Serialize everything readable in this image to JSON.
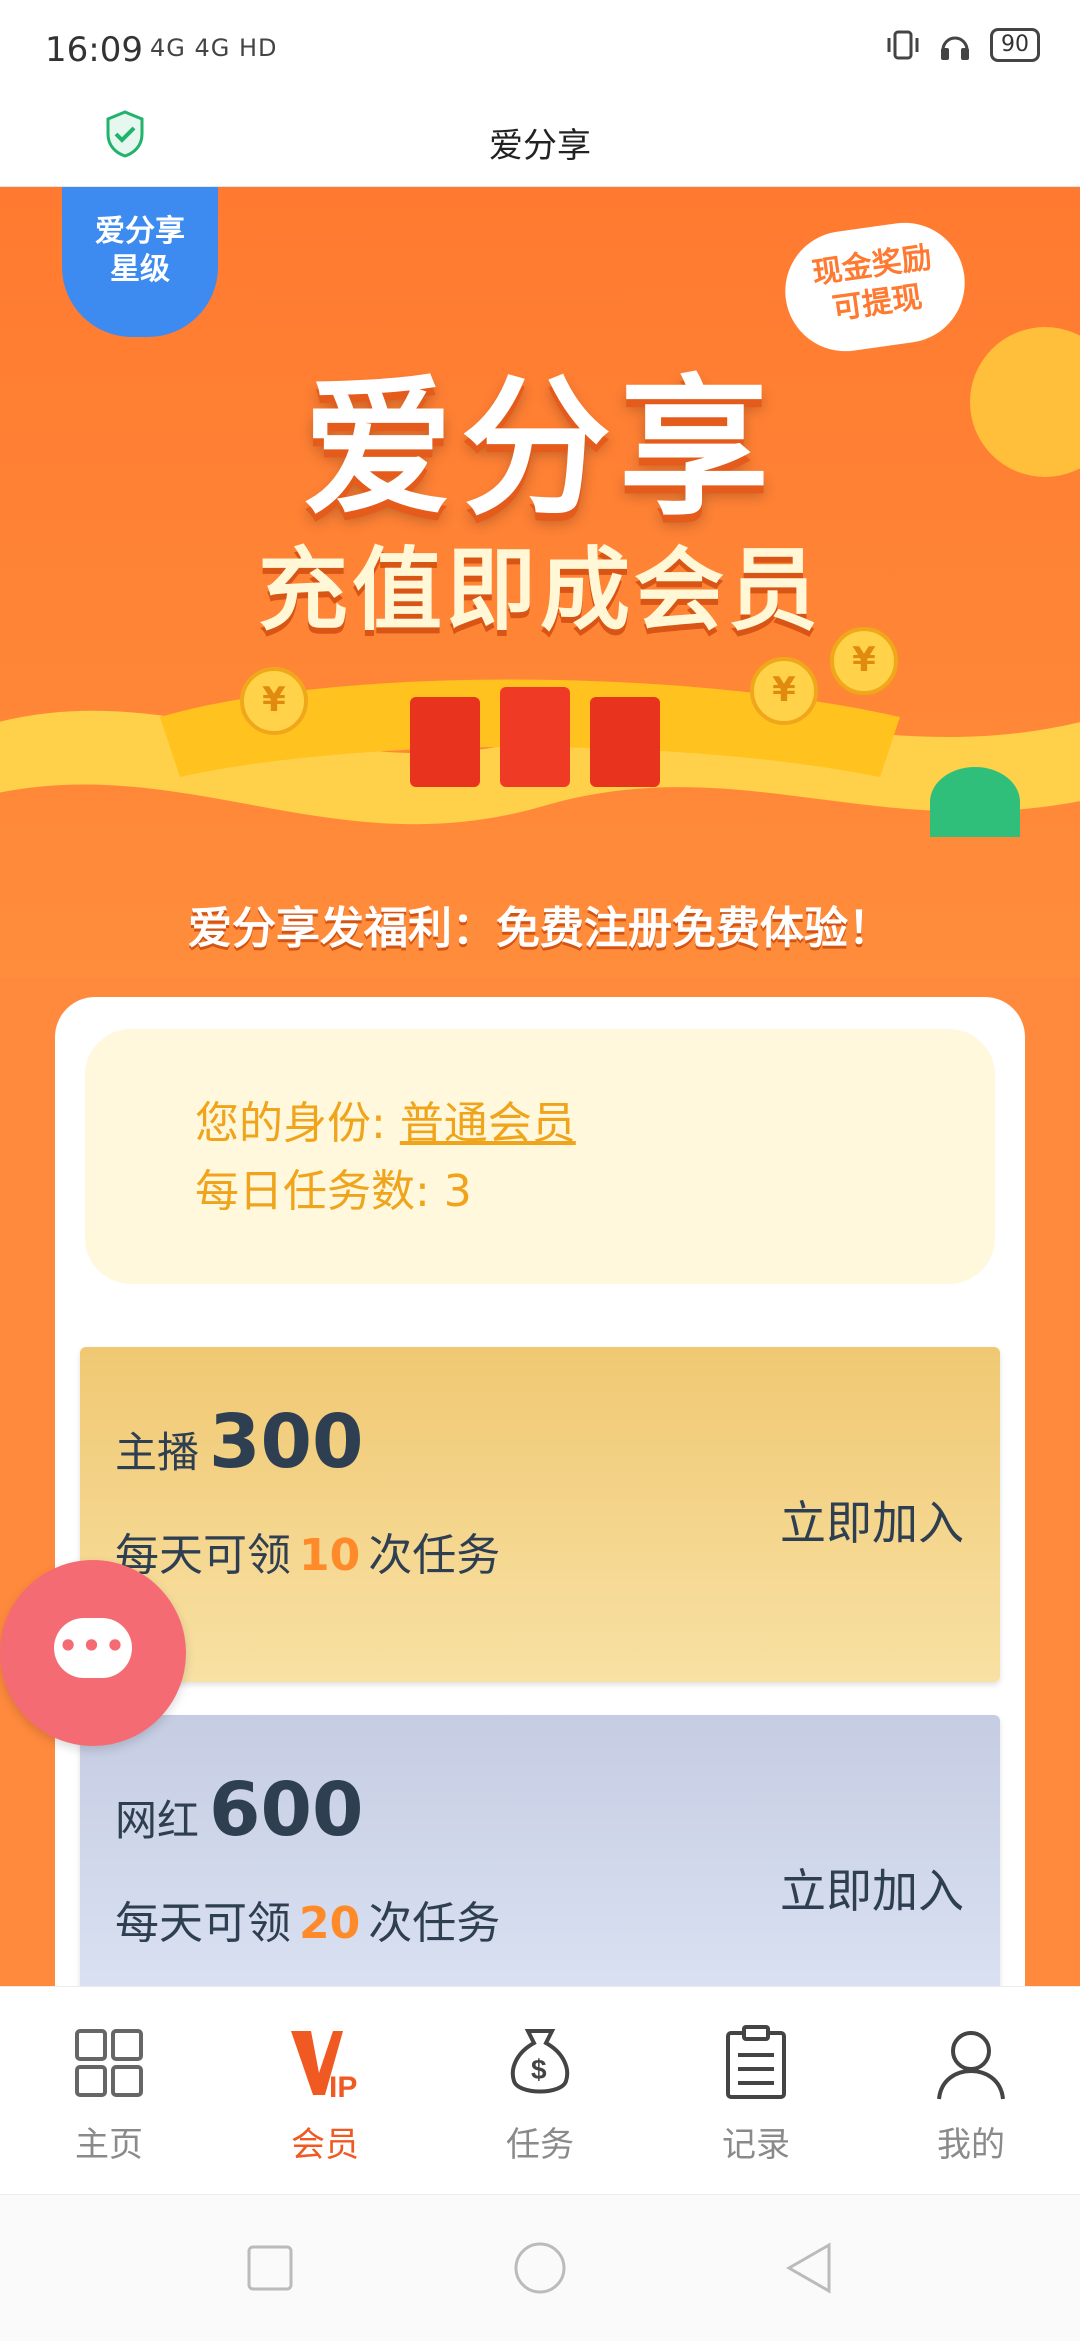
{
  "status_bar": {
    "time": "16:09",
    "network": "4G 4G HD",
    "battery": "90"
  },
  "app_bar": {
    "title": "爱分享",
    "shield_icon": "shield-check-icon"
  },
  "banner": {
    "badge_line1": "爱分享",
    "badge_line2": "星级",
    "cash_line1": "现金奖励",
    "cash_line2": "可提现",
    "title": "爱分享",
    "subtitle": "充值即成会员",
    "welfare": "爱分享发福利：免费注册免费体验！",
    "coin_symbol": "¥"
  },
  "identity": {
    "label": "您的身份: ",
    "value": "普通会员",
    "tasks": "每日任务数: 3"
  },
  "plans": [
    {
      "name": "主播",
      "price": "300",
      "desc_prefix": "每天可领",
      "count": "10",
      "desc_suffix": "次任务",
      "join": "立即加入"
    },
    {
      "name": "网红",
      "price": "600",
      "desc_prefix": "每天可领",
      "count": "20",
      "desc_suffix": "次任务",
      "join": "立即加入"
    }
  ],
  "chat": {
    "dots": "•••",
    "icon": "chat-bubble-icon"
  },
  "tabs": [
    {
      "label": "主页",
      "icon": "grid-icon"
    },
    {
      "label": "会员",
      "icon": "vip-icon",
      "active": true
    },
    {
      "label": "任务",
      "icon": "money-bag-icon"
    },
    {
      "label": "记录",
      "icon": "clipboard-icon"
    },
    {
      "label": "我的",
      "icon": "user-icon"
    }
  ],
  "colors": {
    "accent": "#f05a22",
    "banner_orange": "#ff8a3d",
    "identity_text": "#f0a41b",
    "plan_count": "#ff8a2a",
    "fab": "#f56b73"
  }
}
